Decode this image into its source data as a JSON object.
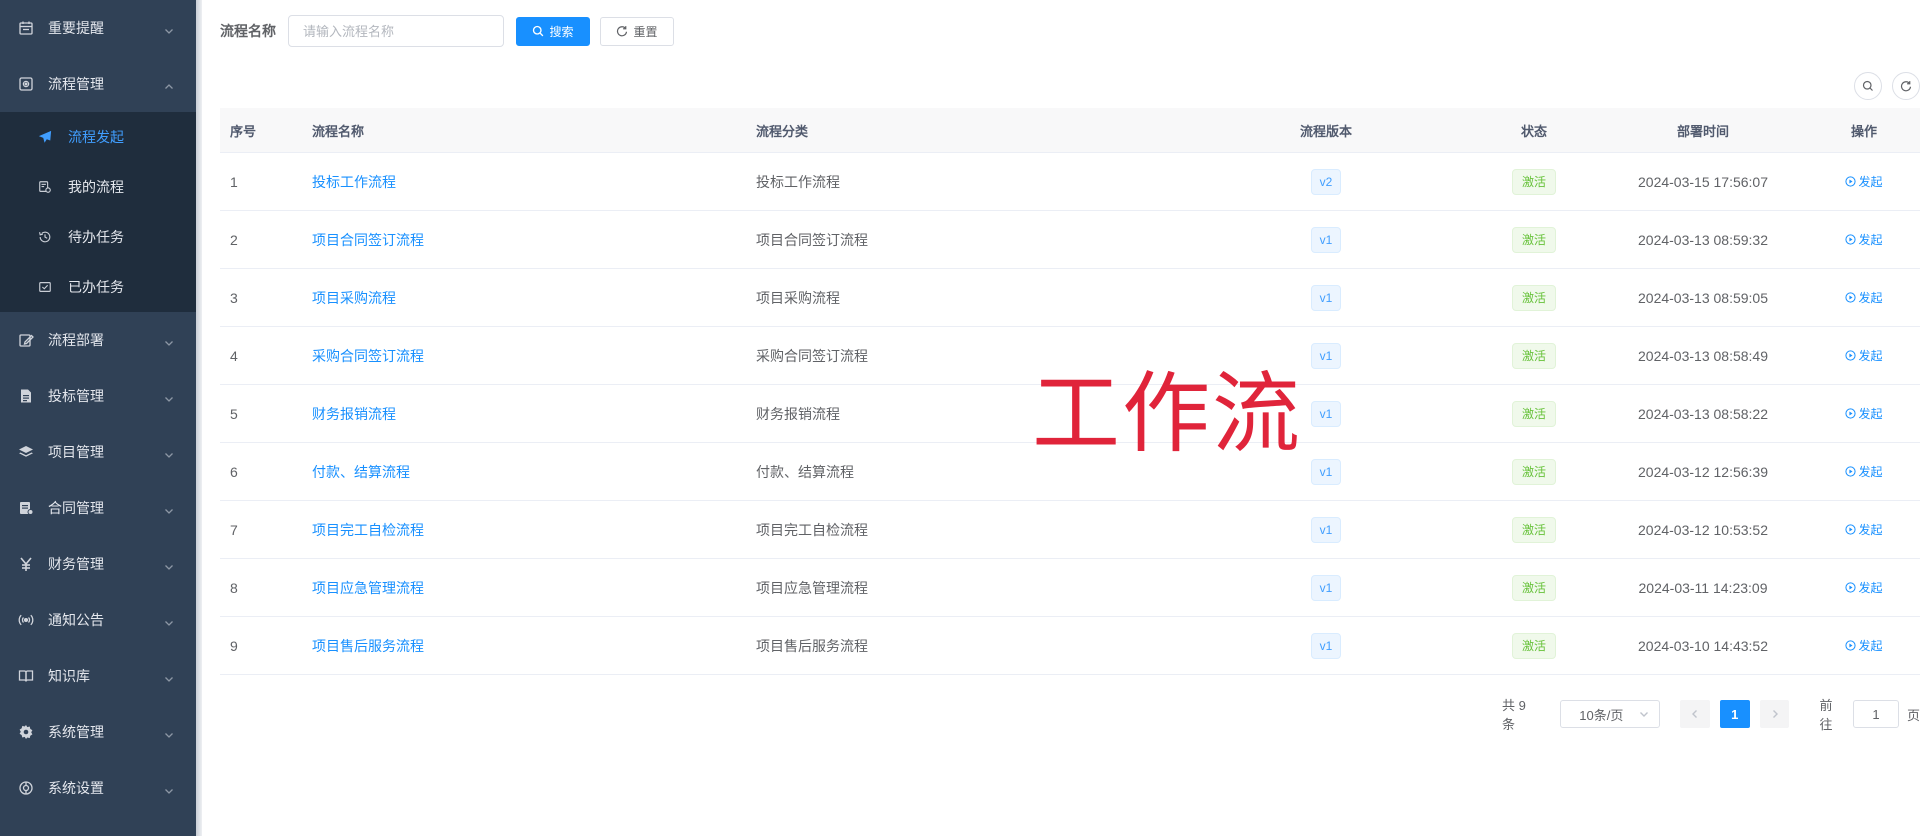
{
  "sidebar": {
    "items": [
      {
        "label": "重要提醒",
        "icon": "calendar-icon",
        "expanded": false
      },
      {
        "label": "流程管理",
        "icon": "process-icon",
        "expanded": true
      },
      {
        "label": "流程部署",
        "icon": "deploy-icon",
        "expanded": false
      },
      {
        "label": "投标管理",
        "icon": "document-icon",
        "expanded": false
      },
      {
        "label": "项目管理",
        "icon": "layers-icon",
        "expanded": false
      },
      {
        "label": "合同管理",
        "icon": "contract-icon",
        "expanded": false
      },
      {
        "label": "财务管理",
        "icon": "yen-icon",
        "expanded": false
      },
      {
        "label": "通知公告",
        "icon": "broadcast-icon",
        "expanded": false
      },
      {
        "label": "知识库",
        "icon": "book-icon",
        "expanded": false
      },
      {
        "label": "系统管理",
        "icon": "gear-icon",
        "expanded": false
      },
      {
        "label": "系统设置",
        "icon": "settings-icon",
        "expanded": false
      }
    ],
    "submenu": [
      {
        "label": "流程发起",
        "icon": "send-icon",
        "active": true
      },
      {
        "label": "我的流程",
        "icon": "my-process-icon",
        "active": false
      },
      {
        "label": "待办任务",
        "icon": "history-icon",
        "active": false
      },
      {
        "label": "已办任务",
        "icon": "mail-check-icon",
        "active": false
      }
    ]
  },
  "search": {
    "label": "流程名称",
    "placeholder": "请输入流程名称",
    "search_button": "搜索",
    "reset_button": "重置"
  },
  "table": {
    "headers": {
      "index": "序号",
      "name": "流程名称",
      "category": "流程分类",
      "version": "流程版本",
      "status": "状态",
      "deploy_time": "部署时间",
      "action": "操作"
    },
    "rows": [
      {
        "index": "1",
        "name": "投标工作流程",
        "category": "投标工作流程",
        "version": "v2",
        "status": "激活",
        "deploy_time": "2024-03-15 17:56:07",
        "action": "发起"
      },
      {
        "index": "2",
        "name": "项目合同签订流程",
        "category": "项目合同签订流程",
        "version": "v1",
        "status": "激活",
        "deploy_time": "2024-03-13 08:59:32",
        "action": "发起"
      },
      {
        "index": "3",
        "name": "项目采购流程",
        "category": "项目采购流程",
        "version": "v1",
        "status": "激活",
        "deploy_time": "2024-03-13 08:59:05",
        "action": "发起"
      },
      {
        "index": "4",
        "name": "采购合同签订流程",
        "category": "采购合同签订流程",
        "version": "v1",
        "status": "激活",
        "deploy_time": "2024-03-13 08:58:49",
        "action": "发起"
      },
      {
        "index": "5",
        "name": "财务报销流程",
        "category": "财务报销流程",
        "version": "v1",
        "status": "激活",
        "deploy_time": "2024-03-13 08:58:22",
        "action": "发起"
      },
      {
        "index": "6",
        "name": "付款、结算流程",
        "category": "付款、结算流程",
        "version": "v1",
        "status": "激活",
        "deploy_time": "2024-03-12 12:56:39",
        "action": "发起"
      },
      {
        "index": "7",
        "name": "项目完工自检流程",
        "category": "项目完工自检流程",
        "version": "v1",
        "status": "激活",
        "deploy_time": "2024-03-12 10:53:52",
        "action": "发起"
      },
      {
        "index": "8",
        "name": "项目应急管理流程",
        "category": "项目应急管理流程",
        "version": "v1",
        "status": "激活",
        "deploy_time": "2024-03-11 14:23:09",
        "action": "发起"
      },
      {
        "index": "9",
        "name": "项目售后服务流程",
        "category": "项目售后服务流程",
        "version": "v1",
        "status": "激活",
        "deploy_time": "2024-03-10 14:43:52",
        "action": "发起"
      }
    ]
  },
  "pagination": {
    "total": "共 9 条",
    "page_size": "10条/页",
    "current_page": "1",
    "goto_label": "前往",
    "goto_value": "1",
    "page_suffix": "页"
  },
  "watermark": "工作流",
  "colors": {
    "sidebar_bg": "#304156",
    "submenu_bg": "#1f2d3d",
    "accent": "#1890ff",
    "active_menu": "#409eff",
    "status_green": "#67c23a",
    "watermark": "#e0243a"
  }
}
